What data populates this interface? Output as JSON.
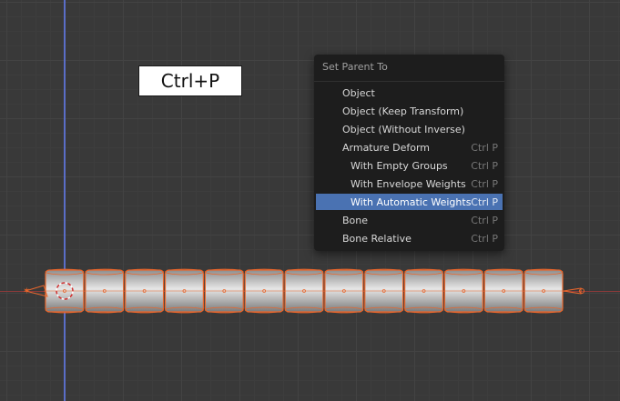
{
  "shortcut_label": "Ctrl+P",
  "menu": {
    "title": "Set Parent To",
    "items": [
      {
        "label": "Object",
        "shortcut": ""
      },
      {
        "label": "Object (Keep Transform)",
        "shortcut": ""
      },
      {
        "label": "Object (Without Inverse)",
        "shortcut": ""
      },
      {
        "label": "Armature Deform",
        "shortcut": "Ctrl P"
      },
      {
        "label": "With Empty Groups",
        "shortcut": "Ctrl P"
      },
      {
        "label": "With Envelope Weights",
        "shortcut": "Ctrl P"
      },
      {
        "label": "With Automatic Weights",
        "shortcut": "Ctrl P"
      },
      {
        "label": "Bone",
        "shortcut": "Ctrl P"
      },
      {
        "label": "Bone Relative",
        "shortcut": "Ctrl P"
      }
    ],
    "highlighted_index": 6
  },
  "colors": {
    "viewport_bg": "#393939",
    "selection_outline": "#e8662c",
    "highlight": "#4a72b2",
    "axis_x": "#8a3a3a",
    "axis_y": "#5a6ec8"
  },
  "scene": {
    "cylinder_segments": 13
  }
}
